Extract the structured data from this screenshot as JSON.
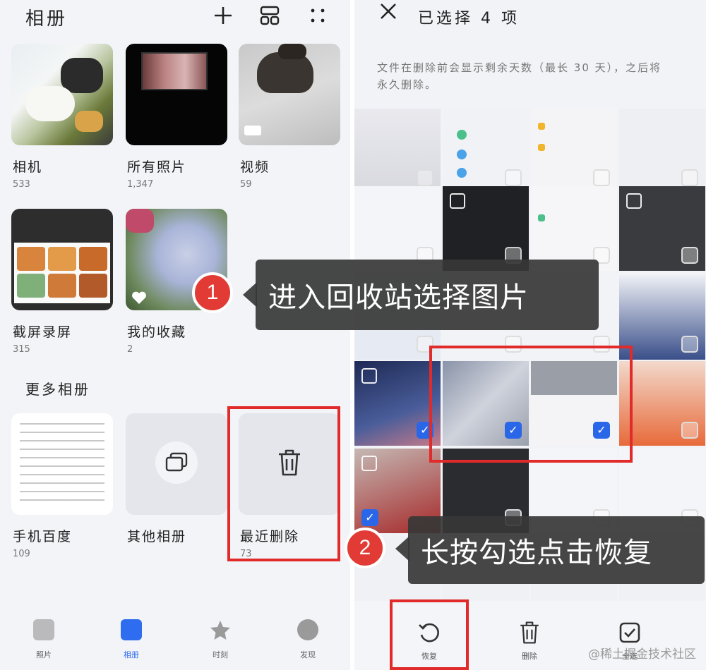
{
  "left": {
    "title": "相册",
    "toolbar": {
      "add_icon": "plus-icon",
      "layout_icon": "grid-layout-icon",
      "more_icon": "more-dots-icon"
    },
    "albums": [
      {
        "name": "相机",
        "count": "533"
      },
      {
        "name": "所有照片",
        "count": "1,347"
      },
      {
        "name": "视频",
        "count": "59"
      },
      {
        "name": "截屏录屏",
        "count": "315"
      },
      {
        "name": "我的收藏",
        "count": "2"
      }
    ],
    "more_section": "更多相册",
    "more_albums": [
      {
        "name": "手机百度",
        "count": "109"
      },
      {
        "name": "其他相册",
        "count": ""
      },
      {
        "name": "最近删除",
        "count": "73"
      }
    ],
    "tabs": [
      {
        "label": "照片",
        "icon": "photo-icon"
      },
      {
        "label": "相册",
        "icon": "album-icon",
        "active": true
      },
      {
        "label": "时刻",
        "icon": "star-icon"
      },
      {
        "label": "发现",
        "icon": "discover-icon"
      }
    ]
  },
  "right": {
    "title": "已选择 4 项",
    "note": "文件在删除前会显示剩余天数（最长 30 天），之后将永久删除。",
    "actions": [
      {
        "label": "恢复",
        "icon": "restore-icon"
      },
      {
        "label": "删除",
        "icon": "trash-icon"
      },
      {
        "label": "全选",
        "icon": "select-all-icon"
      }
    ]
  },
  "callouts": [
    {
      "number": "1",
      "text": "进入回收站选择图片"
    },
    {
      "number": "2",
      "text": "长按勾选点击恢复"
    }
  ],
  "watermark": "@稀土掘金技术社区",
  "colors": {
    "accent_red": "#e12a2a",
    "check_blue": "#2a66e8",
    "album_tab_blue": "#2f6df0"
  }
}
